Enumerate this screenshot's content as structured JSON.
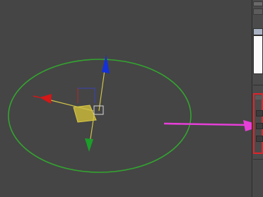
{
  "colors": {
    "viewport_bg": "#454545",
    "circle_helper": "#33a52f",
    "axis_x": "#d41717",
    "axis_y": "#1b9e2a",
    "axis_z": "#1430d8",
    "gizmo_plane": "#c9b73a",
    "annotation_arrow": "#e63fd8",
    "highlight_box": "#e0232a"
  },
  "icons": {
    "viewport_icon": "circle-spline-helper",
    "move_gizmo": "move-transform-gizmo-icon",
    "pointer": "magenta-arrow-icon"
  }
}
